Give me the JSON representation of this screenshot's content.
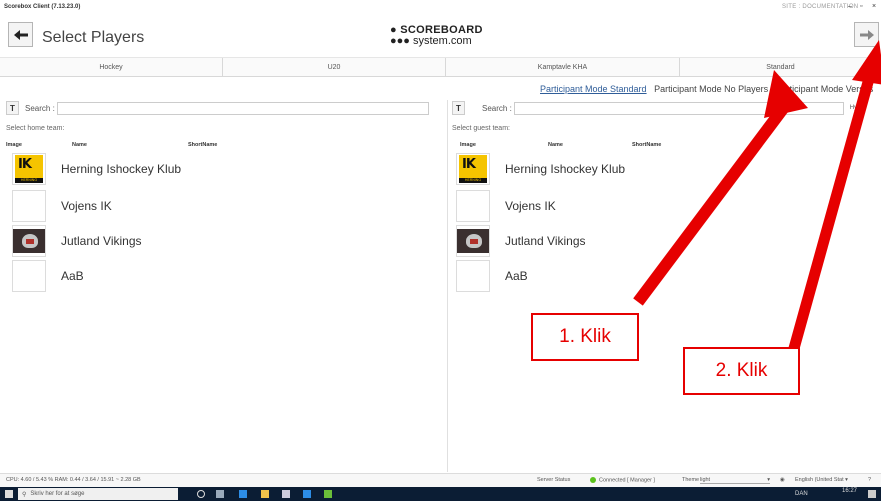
{
  "window": {
    "title": "Scorebox Client (7.13.23.0)",
    "right_label": "SITE : DOCUMENTATION"
  },
  "header": {
    "title": "Select Players",
    "logo_line1": "● SCOREBOARD",
    "logo_line2": "●●● system.com"
  },
  "info_bar": [
    "Hockey",
    "U20",
    "Kamptavle KHA",
    "Standard"
  ],
  "modes": {
    "active": "Participant Mode Standard",
    "no_players": "Participant Mode No Players",
    "versus": "Participant Mode Versus"
  },
  "home": {
    "search_label": "Search :",
    "select_label": "Select home team:",
    "columns": [
      "Image",
      "Name",
      "ShortName"
    ],
    "teams": [
      "Herning Ishockey Klub",
      "Vojens IK",
      "Jutland Vikings",
      "AaB"
    ]
  },
  "guest": {
    "search_label": "Search :",
    "select_label": "Select guest team:",
    "columns": [
      "Image",
      "Name",
      "ShortName"
    ],
    "filter_label": "Hy filt",
    "teams": [
      "Herning Ishockey Klub",
      "Vojens IK",
      "Jutland Vikings",
      "AaB"
    ]
  },
  "status": {
    "metrics": "CPU: 4.60 / 5.43 % RAM: 0.44 / 3.64 / 15.91 ~ 2.28 GB",
    "server_label": "Server Status",
    "connection": "Connected [ Manager ]",
    "theme_label": "Theme",
    "theme_value": "light",
    "language": "English (United Stat"
  },
  "taskbar": {
    "search_placeholder": "Skriv her for at søge",
    "tray": "DAN",
    "time": "16:27"
  },
  "annotations": {
    "first": "1. Klik",
    "second": "2. Klik"
  },
  "colors": {
    "active_mode": "#2f5d99",
    "annotation_red": "#e60000",
    "connected_dot": "#5cc21d",
    "taskbar": "#0b1d34"
  }
}
